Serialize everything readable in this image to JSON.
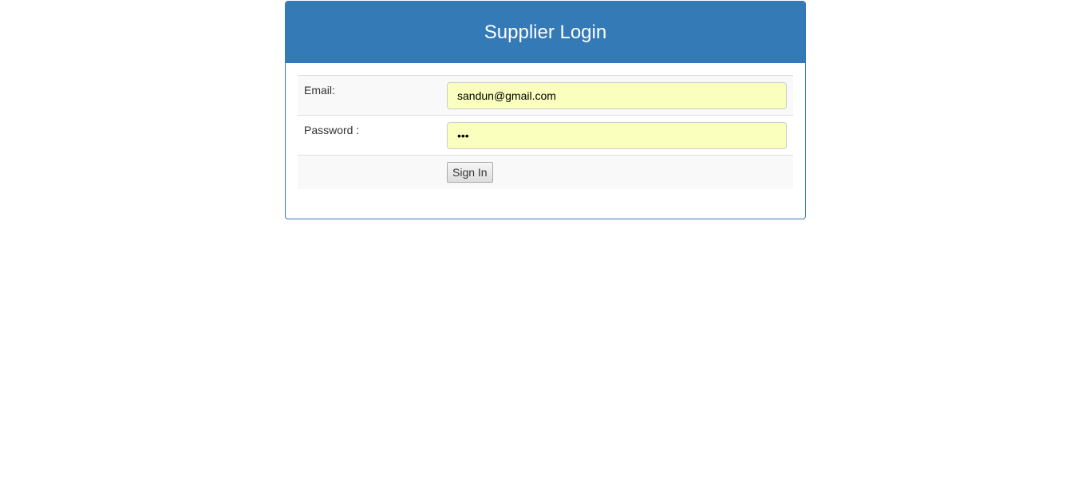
{
  "panel": {
    "title": "Supplier Login"
  },
  "form": {
    "email_label": "Email:",
    "email_value": "sandun@gmail.com",
    "password_label": "Password :",
    "password_value": "•••",
    "signin_label": "Sign In"
  },
  "colors": {
    "accent": "#337ab7",
    "autofill": "#faffbd"
  }
}
